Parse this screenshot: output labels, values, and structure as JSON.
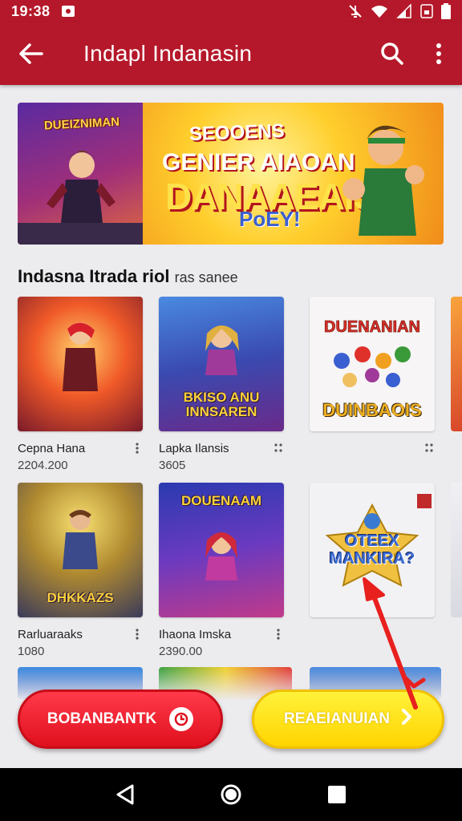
{
  "status_bar": {
    "time": "19:38"
  },
  "app_bar": {
    "title": "Indapl Indanasin",
    "back_icon": "arrow-left-icon",
    "search_icon": "search-icon",
    "menu_icon": "more-vert-icon"
  },
  "banner": {
    "left_logo": "DUEIZNIMAN",
    "line1": "SEOOENS",
    "line2": "GENIER AIAOAN",
    "line3": "DANAAEAIS",
    "line4": "PoEY!"
  },
  "section": {
    "title": "Indasna Itrada riol",
    "subtitle": "ras sanee"
  },
  "cards": [
    {
      "name": "Cepna Hana",
      "sub": "2204.200",
      "thumb_text": "",
      "color1": "#f05a28",
      "color2": "#7a1a2a"
    },
    {
      "name": "Lapka Ilansis",
      "sub": "3605",
      "thumb_text": "BKISO ANU INNSAREN",
      "color1": "#3a6fd0",
      "color2": "#6a2a8a"
    },
    {
      "name": "",
      "sub": "",
      "thumb_text": "DUINBAOIS",
      "color1": "#ffffff",
      "color2": "#f4f0f0"
    },
    {
      "name": "Rarluaraaks",
      "sub": "1080",
      "thumb_text": "DHKKAZS",
      "color1": "#c49a3a",
      "color2": "#3a3a5a"
    },
    {
      "name": "Ihaona Imska",
      "sub": "2390.00",
      "thumb_text": "DOUENAAM",
      "color1": "#3a4ac0",
      "color2": "#c03a8a"
    },
    {
      "name": "",
      "sub": "",
      "thumb_text": "OTEEX MANKIRA?",
      "color1": "#f4f4f6",
      "color2": "#e8e8ec"
    }
  ],
  "buttons": {
    "primary": "BOBANBANTK",
    "secondary": "REAEIANUIAN"
  },
  "colors": {
    "brand": "#b5182a",
    "primary_button": "#e8101e",
    "secondary_button": "#ffd400",
    "annotation_arrow": "#e8201e"
  },
  "nav": {
    "back": "nav-back-icon",
    "home": "nav-home-icon",
    "recents": "nav-recents-icon"
  }
}
